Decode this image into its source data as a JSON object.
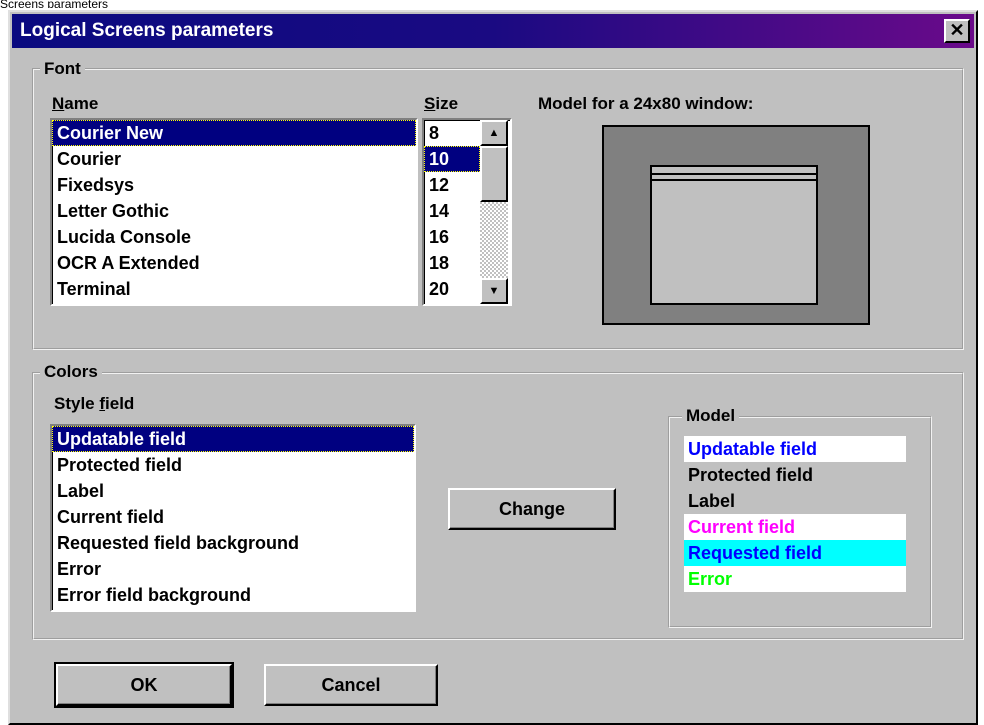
{
  "top_caption": "Screens parameters",
  "dialog": {
    "title": "Logical Screens parameters",
    "close_glyph": "✕"
  },
  "font": {
    "group_label": "Font",
    "name_label": {
      "underlined": "N",
      "rest": "ame"
    },
    "size_label": {
      "underlined": "S",
      "rest": "ize"
    },
    "model_label": "Model for a 24x80 window:",
    "names": [
      "Courier New",
      "Courier",
      "Fixedsys",
      "Letter Gothic",
      "Lucida Console",
      "OCR A Extended",
      "Terminal"
    ],
    "selected_name": "Courier New",
    "sizes": [
      "8",
      "10",
      "12",
      "14",
      "16",
      "18",
      "20"
    ],
    "selected_size": "10"
  },
  "colors": {
    "group_label": "Colors",
    "style_label": {
      "before": "Style ",
      "underlined": "f",
      "after": "ield"
    },
    "styles": [
      "Updatable field",
      "Protected field",
      "Label",
      "Current field",
      "Requested field background",
      "Error",
      "Error field background"
    ],
    "selected_style": "Updatable field",
    "change_button": {
      "before": "Chan",
      "underlined": "g",
      "after": "e"
    },
    "model": {
      "group_label": "Model",
      "rows": [
        {
          "text": "Updatable field",
          "color": "#0000ff",
          "background": "#ffffff"
        },
        {
          "text": "Protected field",
          "color": "#000000",
          "background": "#c0c0c0"
        },
        {
          "text": "Label",
          "color": "#000000",
          "background": "#c0c0c0"
        },
        {
          "text": "Current field",
          "color": "#ff00ff",
          "background": "#ffffff"
        },
        {
          "text": "Requested field",
          "color": "#0000ff",
          "background": "#00ffff"
        },
        {
          "text": "Error",
          "color": "#00ff00",
          "background": "#ffffff"
        }
      ]
    }
  },
  "buttons": {
    "ok": "OK",
    "cancel": "Cancel"
  },
  "icons": {
    "scroll_up": "scroll-up-arrow-icon",
    "scroll_down": "scroll-down-arrow-icon",
    "close": "close-icon"
  },
  "colors_palette": {
    "title_gradient_start": "#0a0a80",
    "title_gradient_end": "#6a0a8a",
    "selection": "#000080",
    "dialog_face": "#c0c0c0"
  }
}
